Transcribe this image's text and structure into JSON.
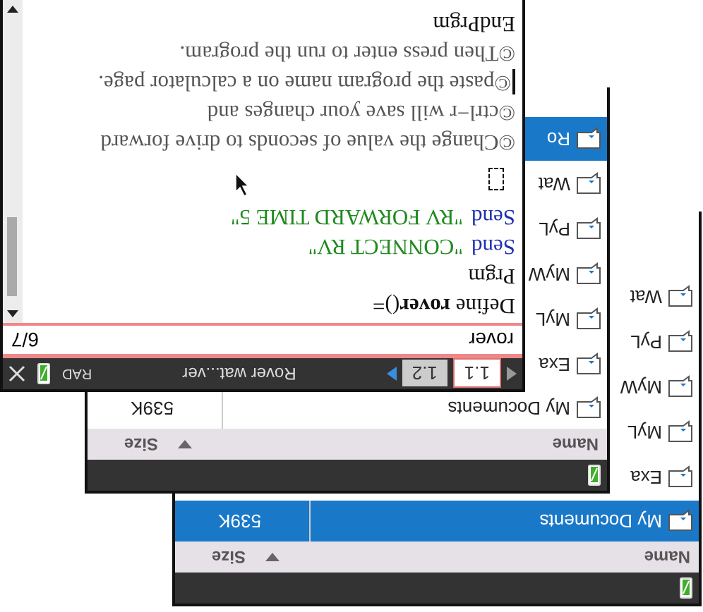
{
  "windows": [
    {
      "kind": "browser",
      "columns": [
        "Name",
        "Size"
      ],
      "rows": [
        {
          "name": "My Documents",
          "size": "539K",
          "selected": true
        },
        {
          "name": "Exa",
          "selected": false
        },
        {
          "name": "MyL",
          "selected": false
        },
        {
          "name": "MyW",
          "selected": false
        },
        {
          "name": "PyL",
          "selected": false
        },
        {
          "name": "Wat",
          "selected": false
        }
      ]
    },
    {
      "kind": "browser",
      "columns": [
        "Name",
        "Size"
      ],
      "rows": [
        {
          "name": "My Documents",
          "size": "539K",
          "selected": false
        },
        {
          "name": "Exa",
          "selected": false
        },
        {
          "name": "MyL",
          "selected": false
        },
        {
          "name": "MyW",
          "selected": false
        },
        {
          "name": "PyL",
          "selected": false
        },
        {
          "name": "Wat",
          "selected": false
        },
        {
          "name": "Ro",
          "selected": true
        }
      ]
    },
    {
      "kind": "editor",
      "tabs": [
        {
          "label": "1.1",
          "selected": true
        },
        {
          "label": "1.2",
          "selected": false
        }
      ],
      "title": "Rover wat...ver",
      "mode": "RAD",
      "program_name": "rover",
      "page": "6/7",
      "lines": [
        {
          "kind": "code",
          "text": "Define **rover**()=",
          "cursor": false
        },
        {
          "kind": "code",
          "text": "Prgm",
          "cursor": false
        },
        {
          "kind": "send",
          "keyword": "Send",
          "text": "\"CONNECT RV\"",
          "cursor": false
        },
        {
          "kind": "send",
          "keyword": "Send",
          "text": "\"RV FORWARD TIME 5\"",
          "cursor": false
        },
        {
          "kind": "placeholder",
          "cursor": false
        },
        {
          "kind": "comment",
          "text": "©Change the value of seconds to drive forward",
          "cursor": false
        },
        {
          "kind": "comment",
          "text": "©ctrl−r will save your changes and",
          "cursor": false
        },
        {
          "kind": "comment",
          "text": "©paste the program name on a calculator page.",
          "cursor": true
        },
        {
          "kind": "comment",
          "text": "©Then press enter to run the program.",
          "cursor": false
        },
        {
          "kind": "code",
          "text": "EndPrgm",
          "cursor": false
        }
      ]
    }
  ]
}
